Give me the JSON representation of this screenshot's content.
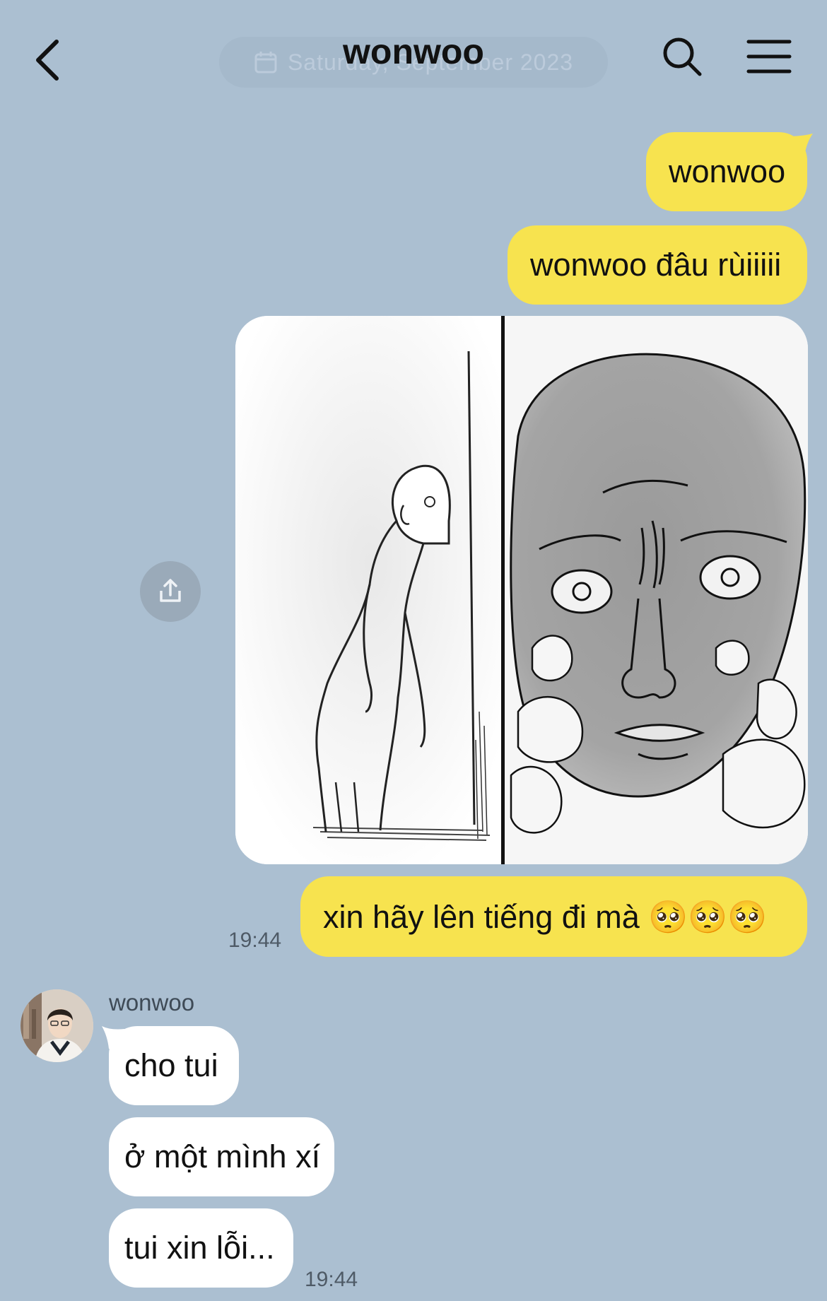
{
  "header": {
    "title": "wonwoo",
    "date_label": "Saturday, September 2023",
    "back_icon": "chevron-left-icon",
    "search_icon": "search-icon",
    "menu_icon": "hamburger-menu-icon"
  },
  "messages": {
    "sent": [
      {
        "text": "wonwoo"
      },
      {
        "text": "wonwoo đâu rùiiiii"
      },
      {
        "text": "xin hãy lên tiếng đi mà 🥺🥺🥺"
      }
    ],
    "sent_time": "19:44",
    "received_sender": "wonwoo",
    "received": [
      {
        "text": "cho tui"
      },
      {
        "text": "ở một mình xí"
      },
      {
        "text": "tui xin lỗi..."
      }
    ],
    "received_time": "19:44"
  },
  "colors": {
    "background": "#abbfd1",
    "sent_bubble": "#f7e34f",
    "received_bubble": "#ffffff"
  }
}
